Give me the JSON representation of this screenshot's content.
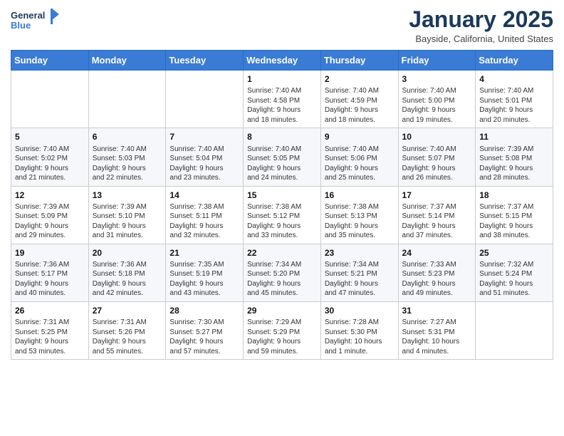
{
  "header": {
    "logo_line1": "General",
    "logo_line2": "Blue",
    "month_title": "January 2025",
    "location": "Bayside, California, United States"
  },
  "weekdays": [
    "Sunday",
    "Monday",
    "Tuesday",
    "Wednesday",
    "Thursday",
    "Friday",
    "Saturday"
  ],
  "weeks": [
    [
      {
        "day": "",
        "info": ""
      },
      {
        "day": "",
        "info": ""
      },
      {
        "day": "",
        "info": ""
      },
      {
        "day": "1",
        "info": "Sunrise: 7:40 AM\nSunset: 4:58 PM\nDaylight: 9 hours\nand 18 minutes."
      },
      {
        "day": "2",
        "info": "Sunrise: 7:40 AM\nSunset: 4:59 PM\nDaylight: 9 hours\nand 18 minutes."
      },
      {
        "day": "3",
        "info": "Sunrise: 7:40 AM\nSunset: 5:00 PM\nDaylight: 9 hours\nand 19 minutes."
      },
      {
        "day": "4",
        "info": "Sunrise: 7:40 AM\nSunset: 5:01 PM\nDaylight: 9 hours\nand 20 minutes."
      }
    ],
    [
      {
        "day": "5",
        "info": "Sunrise: 7:40 AM\nSunset: 5:02 PM\nDaylight: 9 hours\nand 21 minutes."
      },
      {
        "day": "6",
        "info": "Sunrise: 7:40 AM\nSunset: 5:03 PM\nDaylight: 9 hours\nand 22 minutes."
      },
      {
        "day": "7",
        "info": "Sunrise: 7:40 AM\nSunset: 5:04 PM\nDaylight: 9 hours\nand 23 minutes."
      },
      {
        "day": "8",
        "info": "Sunrise: 7:40 AM\nSunset: 5:05 PM\nDaylight: 9 hours\nand 24 minutes."
      },
      {
        "day": "9",
        "info": "Sunrise: 7:40 AM\nSunset: 5:06 PM\nDaylight: 9 hours\nand 25 minutes."
      },
      {
        "day": "10",
        "info": "Sunrise: 7:40 AM\nSunset: 5:07 PM\nDaylight: 9 hours\nand 26 minutes."
      },
      {
        "day": "11",
        "info": "Sunrise: 7:39 AM\nSunset: 5:08 PM\nDaylight: 9 hours\nand 28 minutes."
      }
    ],
    [
      {
        "day": "12",
        "info": "Sunrise: 7:39 AM\nSunset: 5:09 PM\nDaylight: 9 hours\nand 29 minutes."
      },
      {
        "day": "13",
        "info": "Sunrise: 7:39 AM\nSunset: 5:10 PM\nDaylight: 9 hours\nand 31 minutes."
      },
      {
        "day": "14",
        "info": "Sunrise: 7:38 AM\nSunset: 5:11 PM\nDaylight: 9 hours\nand 32 minutes."
      },
      {
        "day": "15",
        "info": "Sunrise: 7:38 AM\nSunset: 5:12 PM\nDaylight: 9 hours\nand 33 minutes."
      },
      {
        "day": "16",
        "info": "Sunrise: 7:38 AM\nSunset: 5:13 PM\nDaylight: 9 hours\nand 35 minutes."
      },
      {
        "day": "17",
        "info": "Sunrise: 7:37 AM\nSunset: 5:14 PM\nDaylight: 9 hours\nand 37 minutes."
      },
      {
        "day": "18",
        "info": "Sunrise: 7:37 AM\nSunset: 5:15 PM\nDaylight: 9 hours\nand 38 minutes."
      }
    ],
    [
      {
        "day": "19",
        "info": "Sunrise: 7:36 AM\nSunset: 5:17 PM\nDaylight: 9 hours\nand 40 minutes."
      },
      {
        "day": "20",
        "info": "Sunrise: 7:36 AM\nSunset: 5:18 PM\nDaylight: 9 hours\nand 42 minutes."
      },
      {
        "day": "21",
        "info": "Sunrise: 7:35 AM\nSunset: 5:19 PM\nDaylight: 9 hours\nand 43 minutes."
      },
      {
        "day": "22",
        "info": "Sunrise: 7:34 AM\nSunset: 5:20 PM\nDaylight: 9 hours\nand 45 minutes."
      },
      {
        "day": "23",
        "info": "Sunrise: 7:34 AM\nSunset: 5:21 PM\nDaylight: 9 hours\nand 47 minutes."
      },
      {
        "day": "24",
        "info": "Sunrise: 7:33 AM\nSunset: 5:23 PM\nDaylight: 9 hours\nand 49 minutes."
      },
      {
        "day": "25",
        "info": "Sunrise: 7:32 AM\nSunset: 5:24 PM\nDaylight: 9 hours\nand 51 minutes."
      }
    ],
    [
      {
        "day": "26",
        "info": "Sunrise: 7:31 AM\nSunset: 5:25 PM\nDaylight: 9 hours\nand 53 minutes."
      },
      {
        "day": "27",
        "info": "Sunrise: 7:31 AM\nSunset: 5:26 PM\nDaylight: 9 hours\nand 55 minutes."
      },
      {
        "day": "28",
        "info": "Sunrise: 7:30 AM\nSunset: 5:27 PM\nDaylight: 9 hours\nand 57 minutes."
      },
      {
        "day": "29",
        "info": "Sunrise: 7:29 AM\nSunset: 5:29 PM\nDaylight: 9 hours\nand 59 minutes."
      },
      {
        "day": "30",
        "info": "Sunrise: 7:28 AM\nSunset: 5:30 PM\nDaylight: 10 hours\nand 1 minute."
      },
      {
        "day": "31",
        "info": "Sunrise: 7:27 AM\nSunset: 5:31 PM\nDaylight: 10 hours\nand 4 minutes."
      },
      {
        "day": "",
        "info": ""
      }
    ]
  ]
}
